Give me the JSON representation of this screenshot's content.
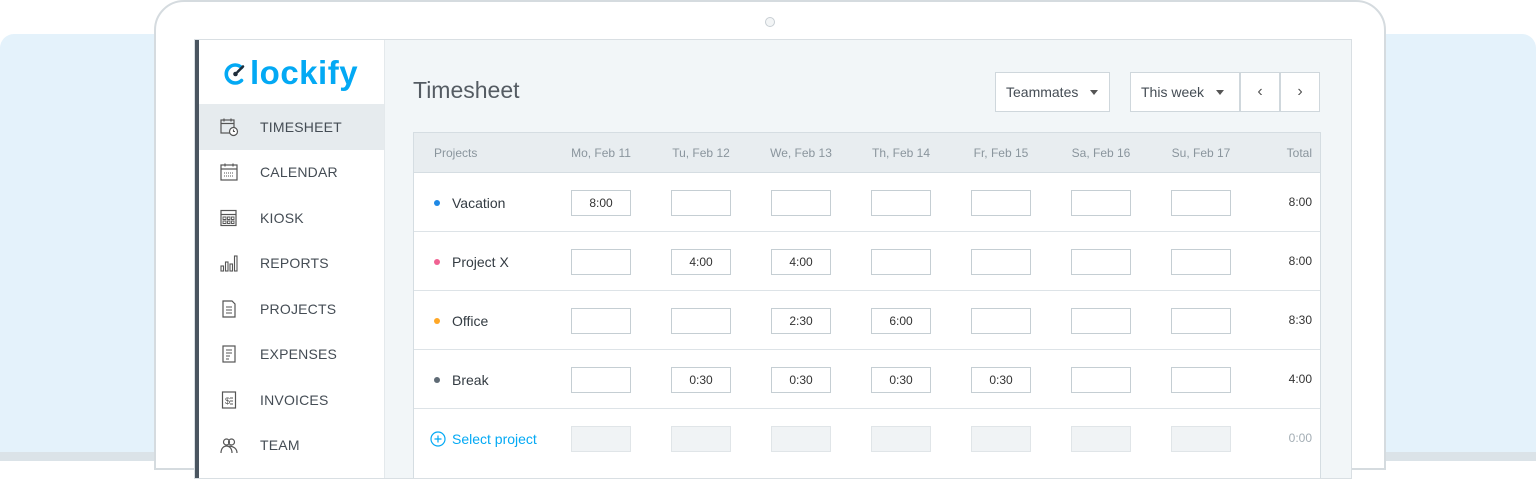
{
  "app": {
    "logo_text": "lockify",
    "brand_color": "#03a9f4"
  },
  "sidebar": {
    "items": [
      {
        "label": "TIMESHEET",
        "icon": "timesheet-icon",
        "active": true
      },
      {
        "label": "CALENDAR",
        "icon": "calendar-icon",
        "active": false
      },
      {
        "label": "KIOSK",
        "icon": "kiosk-icon",
        "active": false
      },
      {
        "label": "REPORTS",
        "icon": "reports-icon",
        "active": false
      },
      {
        "label": "PROJECTS",
        "icon": "projects-icon",
        "active": false
      },
      {
        "label": "EXPENSES",
        "icon": "expenses-icon",
        "active": false
      },
      {
        "label": "INVOICES",
        "icon": "invoices-icon",
        "active": false
      },
      {
        "label": "TEAM",
        "icon": "team-icon",
        "active": false
      }
    ]
  },
  "header": {
    "title": "Timesheet",
    "teammates_label": "Teammates",
    "range_label": "This week",
    "prev_label": "‹",
    "next_label": "›"
  },
  "table": {
    "columns": {
      "projects": "Projects",
      "days": [
        "Mo, Feb 11",
        "Tu, Feb 12",
        "We, Feb 13",
        "Th, Feb 14",
        "Fr, Feb 15",
        "Sa, Feb 16",
        "Su, Feb 17"
      ],
      "total": "Total"
    },
    "rows": [
      {
        "project": "Vacation",
        "color": "#1e88e5",
        "cells": [
          "8:00",
          "",
          "",
          "",
          "",
          "",
          ""
        ],
        "total": "8:00"
      },
      {
        "project": "Project X",
        "color": "#f06292",
        "cells": [
          "",
          "4:00",
          "4:00",
          "",
          "",
          "",
          ""
        ],
        "total": "8:00"
      },
      {
        "project": "Office",
        "color": "#ffa726",
        "cells": [
          "",
          "",
          "2:30",
          "6:00",
          "",
          "",
          ""
        ],
        "total": "8:30"
      },
      {
        "project": "Break",
        "color": "#5f6b75",
        "cells": [
          "",
          "0:30",
          "0:30",
          "0:30",
          "0:30",
          "",
          ""
        ],
        "total": "4:00"
      }
    ],
    "select_row": {
      "label": "Select project",
      "total": "0:00"
    }
  }
}
